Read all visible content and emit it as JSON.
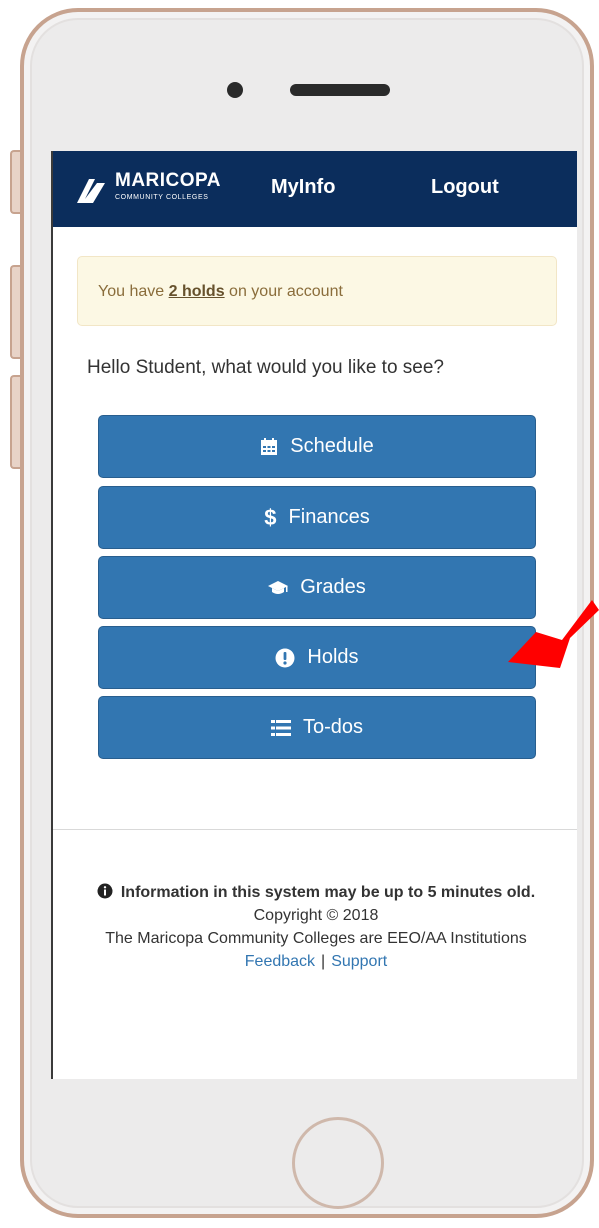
{
  "header": {
    "brand_name": "MARICOPA",
    "brand_sub": "COMMUNITY COLLEGES",
    "nav_myinfo": "MyInfo",
    "nav_logout": "Logout"
  },
  "alert": {
    "prefix": "You have ",
    "link": "2 holds",
    "suffix": " on your account"
  },
  "greeting": "Hello Student, what would you like to see?",
  "menu": [
    {
      "label": "Schedule",
      "icon": "calendar-icon"
    },
    {
      "label": "Finances",
      "icon": "dollar-icon"
    },
    {
      "label": "Grades",
      "icon": "graduation-cap-icon"
    },
    {
      "label": "Holds",
      "icon": "exclamation-circle-icon"
    },
    {
      "label": "To-dos",
      "icon": "list-icon"
    }
  ],
  "footer": {
    "info": "Information in this system may be up to 5 minutes old.",
    "copyright": "Copyright © 2018",
    "eeo": "The Maricopa Community Colleges are EEO/AA Institutions",
    "feedback": "Feedback",
    "separator": "|",
    "support": "Support"
  },
  "colors": {
    "navbar": "#0b2d5c",
    "button": "#3276b1",
    "alert_bg": "#fcf8e4",
    "annotation_arrow": "#ff0000"
  }
}
